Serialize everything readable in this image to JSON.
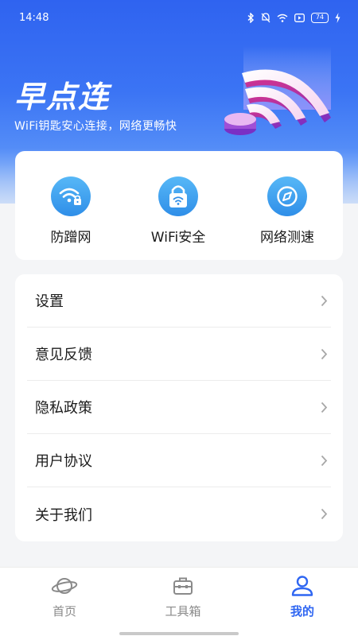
{
  "status_bar": {
    "time": "14:48",
    "battery": "74",
    "icons": [
      "bluetooth-icon",
      "mute-icon",
      "wifi-icon",
      "media-icon",
      "battery-icon",
      "charging-icon"
    ]
  },
  "header": {
    "title": "早点连",
    "subtitle": "WiFi钥匙安心连接，网络更畅快"
  },
  "tools": [
    {
      "label": "防蹭网",
      "icon": "wifi-lock-icon"
    },
    {
      "label": "WiFi安全",
      "icon": "padlock-icon"
    },
    {
      "label": "网络测速",
      "icon": "compass-icon"
    }
  ],
  "menu": [
    {
      "label": "设置"
    },
    {
      "label": "意见反馈"
    },
    {
      "label": "隐私政策"
    },
    {
      "label": "用户协议"
    },
    {
      "label": "关于我们"
    }
  ],
  "tabs": [
    {
      "label": "首页",
      "icon": "planet-icon",
      "active": false
    },
    {
      "label": "工具箱",
      "icon": "toolbox-icon",
      "active": false
    },
    {
      "label": "我的",
      "icon": "user-icon",
      "active": true
    }
  ],
  "colors": {
    "accent": "#2f66f2",
    "hero_top": "#2f63f0",
    "tool_icon": "#2f8ee8",
    "inactive_tab": "#8a8a8a"
  }
}
